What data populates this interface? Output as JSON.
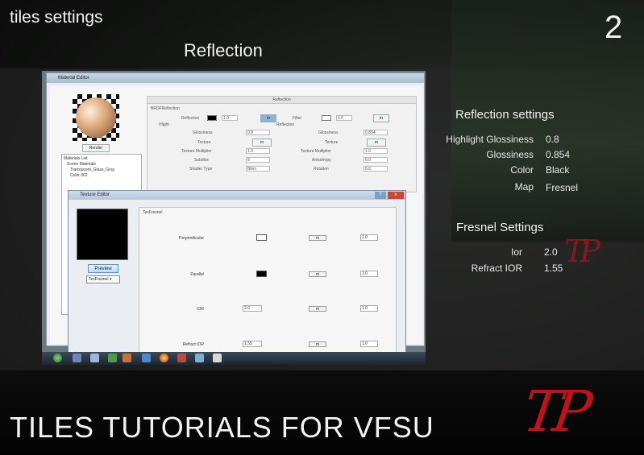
{
  "header": {
    "top_left_title": "tiles settings",
    "page_number": "2",
    "section_title": "Reflection",
    "bottom_title": "TILES TUTORIALS  FOR VFSU"
  },
  "logos": {
    "big": "TP",
    "small": "TP"
  },
  "reflection_settings": {
    "heading": "Reflection settings",
    "rows": [
      {
        "label": "Highlight Glossiness",
        "value": "0.8"
      },
      {
        "label": "Glossiness",
        "value": "0.854"
      },
      {
        "label": "Color",
        "value": "Black"
      },
      {
        "label": "Map",
        "value": "Fresnel"
      }
    ]
  },
  "fresnel_settings": {
    "heading": "Fresnel Settings",
    "rows": [
      {
        "label": "Ior",
        "value": "2.0"
      },
      {
        "label": "Refract IOR",
        "value": "1.55"
      }
    ]
  },
  "material_editor": {
    "title": "Material Editor",
    "render_button": "Render",
    "list_title": "Materials List",
    "list_items": [
      "Scene Materials",
      "Translucent_Glass_Gray",
      "Color 002"
    ],
    "panel_title": "Reflection",
    "brdf_title": "BRDFReflection",
    "labels": {
      "reflection": "Reflection",
      "filter": "Filter",
      "hlight": "Hlight",
      "reflection2": "Reflection",
      "glossiness": "Glossiness",
      "glossiness2": "Glossiness",
      "texture": "Texture",
      "texture2": "Texture",
      "texture_multiplier": "Texture Multiplier",
      "texture_multiplier2": "Texture Multiplier",
      "subdivs": "Subdivs",
      "anisotropy": "Anisotropy",
      "shader_type": "Shader Type",
      "rotation": "Rotation"
    },
    "values": {
      "reflection_value": "1.0",
      "filter_value": "1.0",
      "hl_glossiness": "0.8",
      "glossiness": "0.854",
      "tex_mult_1": "1.0",
      "tex_mult_2": "1.0",
      "subdivs": "8",
      "anisotropy": "0.0",
      "shader_type": "Blinn",
      "rotation": "0.0",
      "m": "m"
    }
  },
  "texture_editor": {
    "title": "Texture Editor",
    "preview_button": "Preview",
    "texture_type": "TexFresnel",
    "panel_title": "TexFresnel",
    "win_help": "?",
    "win_close": "x",
    "rows": [
      {
        "label": "Perpendicular",
        "value": "1.0",
        "swatch": "#ffffff",
        "m": "m"
      },
      {
        "label": "Parallel",
        "value": "1.0",
        "swatch": "#000000",
        "m": "m"
      },
      {
        "label": "IOR",
        "value": "1.0",
        "ior": "2.0",
        "m": "m"
      },
      {
        "label": "Refract IOR",
        "value": "1.0",
        "ior": "1.55",
        "m": "m"
      }
    ]
  },
  "colors": {
    "logo_red": "#c0121a",
    "preview_button_blue": "#5a90c8"
  }
}
